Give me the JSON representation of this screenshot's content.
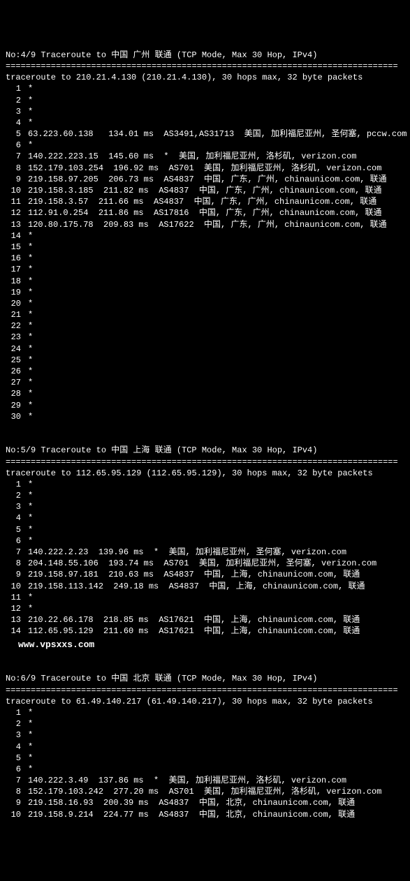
{
  "watermark": "www.vpsxxs.com",
  "sep": "==============================================================================",
  "blocks": [
    {
      "header": "No:4/9 Traceroute to 中国 广州 联通 (TCP Mode, Max 30 Hop, IPv4)",
      "subheader": "traceroute to 210.21.4.130 (210.21.4.130), 30 hops max, 32 byte packets",
      "hops": [
        {
          "n": 1,
          "line": "*"
        },
        {
          "n": 2,
          "line": "*"
        },
        {
          "n": 3,
          "line": "*"
        },
        {
          "n": 4,
          "line": "*"
        },
        {
          "n": 5,
          "line": "63.223.60.138   134.01 ms  AS3491,AS31713  美国, 加利福尼亚州, 圣何塞, pccw.com"
        },
        {
          "n": 6,
          "line": "*"
        },
        {
          "n": 7,
          "line": "140.222.223.15  145.60 ms  *  美国, 加利福尼亚州, 洛杉矶, verizon.com"
        },
        {
          "n": 8,
          "line": "152.179.103.254  196.92 ms  AS701  美国, 加利福尼亚州, 洛杉矶, verizon.com"
        },
        {
          "n": 9,
          "line": "219.158.97.205  206.73 ms  AS4837  中国, 广东, 广州, chinaunicom.com, 联通"
        },
        {
          "n": 10,
          "line": "219.158.3.185  211.82 ms  AS4837  中国, 广东, 广州, chinaunicom.com, 联通"
        },
        {
          "n": 11,
          "line": "219.158.3.57  211.66 ms  AS4837  中国, 广东, 广州, chinaunicom.com, 联通"
        },
        {
          "n": 12,
          "line": "112.91.0.254  211.86 ms  AS17816  中国, 广东, 广州, chinaunicom.com, 联通"
        },
        {
          "n": 13,
          "line": "120.80.175.78  209.83 ms  AS17622  中国, 广东, 广州, chinaunicom.com, 联通"
        },
        {
          "n": 14,
          "line": "*"
        },
        {
          "n": 15,
          "line": "*"
        },
        {
          "n": 16,
          "line": "*"
        },
        {
          "n": 17,
          "line": "*"
        },
        {
          "n": 18,
          "line": "*"
        },
        {
          "n": 19,
          "line": "*"
        },
        {
          "n": 20,
          "line": "*"
        },
        {
          "n": 21,
          "line": "*"
        },
        {
          "n": 22,
          "line": "*"
        },
        {
          "n": 23,
          "line": "*"
        },
        {
          "n": 24,
          "line": "*"
        },
        {
          "n": 25,
          "line": "*"
        },
        {
          "n": 26,
          "line": "*"
        },
        {
          "n": 27,
          "line": "*"
        },
        {
          "n": 28,
          "line": "*"
        },
        {
          "n": 29,
          "line": "*"
        },
        {
          "n": 30,
          "line": "*"
        }
      ]
    },
    {
      "header": "No:5/9 Traceroute to 中国 上海 联通 (TCP Mode, Max 30 Hop, IPv4)",
      "subheader": "traceroute to 112.65.95.129 (112.65.95.129), 30 hops max, 32 byte packets",
      "hops": [
        {
          "n": 1,
          "line": "*"
        },
        {
          "n": 2,
          "line": "*"
        },
        {
          "n": 3,
          "line": "*"
        },
        {
          "n": 4,
          "line": "*"
        },
        {
          "n": 5,
          "line": "*"
        },
        {
          "n": 6,
          "line": "*"
        },
        {
          "n": 7,
          "line": "140.222.2.23  139.96 ms  *  美国, 加利福尼亚州, 圣何塞, verizon.com"
        },
        {
          "n": 8,
          "line": "204.148.55.106  193.74 ms  AS701  美国, 加利福尼亚州, 圣何塞, verizon.com"
        },
        {
          "n": 9,
          "line": "219.158.97.181  210.63 ms  AS4837  中国, 上海, chinaunicom.com, 联通"
        },
        {
          "n": 10,
          "line": "219.158.113.142  249.18 ms  AS4837  中国, 上海, chinaunicom.com, 联通"
        },
        {
          "n": 11,
          "line": "*"
        },
        {
          "n": 12,
          "line": "*"
        },
        {
          "n": 13,
          "line": "210.22.66.178  218.85 ms  AS17621  中国, 上海, chinaunicom.com, 联通"
        },
        {
          "n": 14,
          "line": "112.65.95.129  211.60 ms  AS17621  中国, 上海, chinaunicom.com, 联通"
        }
      ],
      "watermark_after": true
    },
    {
      "header": "No:6/9 Traceroute to 中国 北京 联通 (TCP Mode, Max 30 Hop, IPv4)",
      "subheader": "traceroute to 61.49.140.217 (61.49.140.217), 30 hops max, 32 byte packets",
      "hops": [
        {
          "n": 1,
          "line": "*"
        },
        {
          "n": 2,
          "line": "*"
        },
        {
          "n": 3,
          "line": "*"
        },
        {
          "n": 4,
          "line": "*"
        },
        {
          "n": 5,
          "line": "*"
        },
        {
          "n": 6,
          "line": "*"
        },
        {
          "n": 7,
          "line": "140.222.3.49  137.86 ms  *  美国, 加利福尼亚州, 洛杉矶, verizon.com"
        },
        {
          "n": 8,
          "line": "152.179.103.242  277.20 ms  AS701  美国, 加利福尼亚州, 洛杉矶, verizon.com"
        },
        {
          "n": 9,
          "line": "219.158.16.93  200.39 ms  AS4837  中国, 北京, chinaunicom.com, 联通"
        },
        {
          "n": 10,
          "line": "219.158.9.214  224.77 ms  AS4837  中国, 北京, chinaunicom.com, 联通"
        }
      ]
    }
  ]
}
